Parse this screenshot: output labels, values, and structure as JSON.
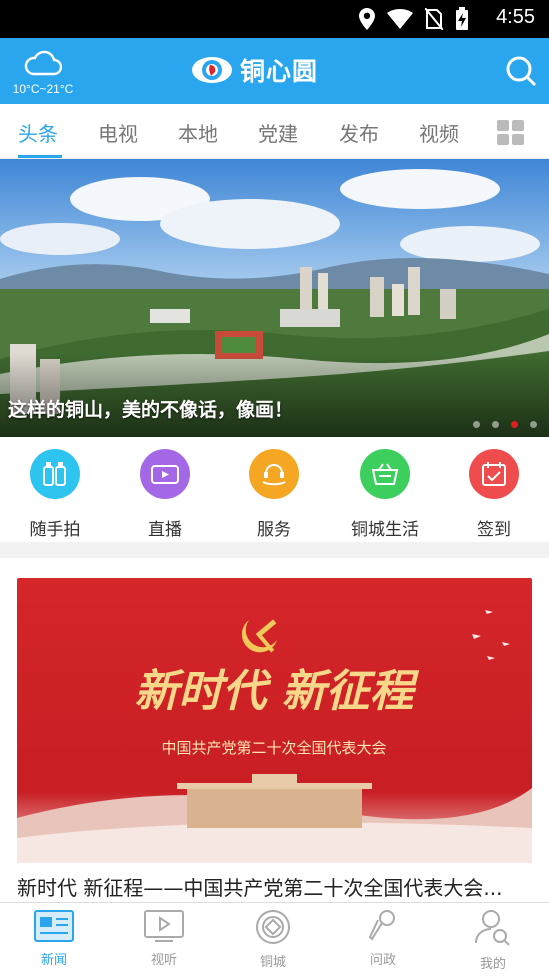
{
  "status_bar": {
    "time": "4:55",
    "icons": [
      "location-icon",
      "wifi-icon",
      "no-sim-icon",
      "battery-charging-icon"
    ]
  },
  "header": {
    "weather_temp": "10°C~21°C",
    "app_name": "铜心圆",
    "accent": "#2aa6ee"
  },
  "tabs": [
    {
      "label": "头条",
      "active": true
    },
    {
      "label": "电视",
      "active": false
    },
    {
      "label": "本地",
      "active": false
    },
    {
      "label": "党建",
      "active": false
    },
    {
      "label": "发布",
      "active": false
    },
    {
      "label": "视频",
      "active": false
    }
  ],
  "banner": {
    "caption": "这样的铜山，美的不像话，像画！",
    "active_dot": 2,
    "dot_count": 4
  },
  "quick_actions": [
    {
      "label": "随手拍",
      "icon": "bottles-icon",
      "color": "#2ec4f0"
    },
    {
      "label": "直播",
      "icon": "video-camera-icon",
      "color": "#a468e6"
    },
    {
      "label": "服务",
      "icon": "service-headset-icon",
      "color": "#f5a623"
    },
    {
      "label": "铜城生活",
      "icon": "shopping-basket-icon",
      "color": "#3ccf5e"
    },
    {
      "label": "签到",
      "icon": "calendar-check-icon",
      "color": "#ef4d4d"
    }
  ],
  "feature": {
    "image_headline": "新时代 新征程",
    "image_subtitle": "中国共产党第二十次全国代表大会",
    "title": "新时代 新征程——中国共产党第二十次全国代表大会..."
  },
  "bottom_nav": [
    {
      "label": "新闻",
      "icon": "newspaper-icon",
      "active": true
    },
    {
      "label": "视听",
      "icon": "play-screen-icon",
      "active": false
    },
    {
      "label": "铜城",
      "icon": "coin-city-icon",
      "active": false
    },
    {
      "label": "问政",
      "icon": "microphone-icon",
      "active": false
    },
    {
      "label": "我的",
      "icon": "user-search-icon",
      "active": false
    }
  ]
}
